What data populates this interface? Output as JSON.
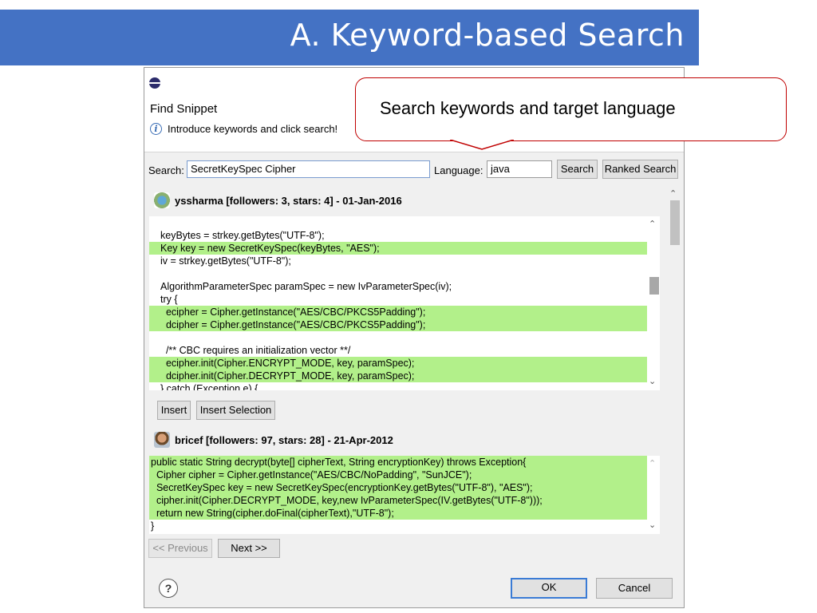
{
  "slide": {
    "title": "A.  Keyword-based Search"
  },
  "dialog": {
    "title": "Find Snippet",
    "info": "Introduce keywords and click search!",
    "search_label": "Search:",
    "search_value": "SecretKeySpec Cipher",
    "language_label": "Language:",
    "language_value": "java",
    "search_button": "Search",
    "ranked_button": "Ranked Search",
    "insert_button": "Insert",
    "insert_selection_button": "Insert Selection",
    "prev_button": "<< Previous",
    "next_button": "Next >>",
    "ok_button": "OK",
    "cancel_button": "Cancel",
    "help_icon": "?"
  },
  "results": [
    {
      "author": "yssharma  [followers: 3, stars: 4] - 01-Jan-2016",
      "lines": [
        "",
        "keyBytes = strkey.getBytes(\"UTF-8\");",
        "Key key = new SecretKeySpec(keyBytes, \"AES\");",
        "iv = strkey.getBytes(\"UTF-8\");",
        "",
        "AlgorithmParameterSpec paramSpec = new IvParameterSpec(iv);",
        "try {",
        "  ecipher = Cipher.getInstance(\"AES/CBC/PKCS5Padding\");",
        "  dcipher = Cipher.getInstance(\"AES/CBC/PKCS5Padding\");",
        "",
        "  /** CBC requires an initialization vector **/",
        "  ecipher.init(Cipher.ENCRYPT_MODE, key, paramSpec);",
        "  dcipher.init(Cipher.DECRYPT_MODE, key, paramSpec);",
        "} catch (Exception e) {"
      ]
    },
    {
      "author": "bricef  [followers: 97, stars: 28] - 21-Apr-2012",
      "lines": [
        "public static String decrypt(byte[] cipherText, String encryptionKey) throws Exception{",
        "  Cipher cipher = Cipher.getInstance(\"AES/CBC/NoPadding\", \"SunJCE\");",
        "  SecretKeySpec key = new SecretKeySpec(encryptionKey.getBytes(\"UTF-8\"), \"AES\");",
        "  cipher.init(Cipher.DECRYPT_MODE, key,new IvParameterSpec(IV.getBytes(\"UTF-8\")));",
        "  return new String(cipher.doFinal(cipherText),\"UTF-8\");",
        "}"
      ]
    }
  ],
  "callout": {
    "text": "Search keywords and target language"
  },
  "colors": {
    "banner": "#4472c4",
    "highlight": "#b2f08a",
    "callout_border": "#c00000"
  }
}
